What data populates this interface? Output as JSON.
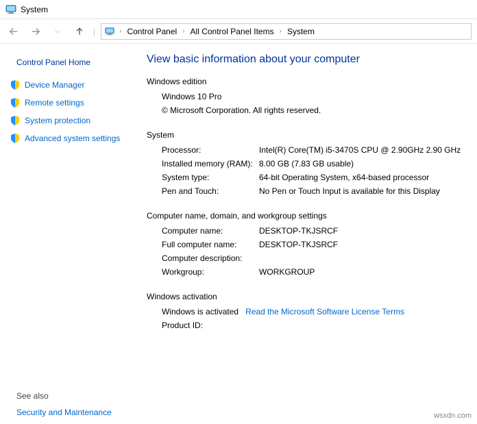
{
  "window": {
    "title": "System"
  },
  "breadcrumb": {
    "a": "Control Panel",
    "b": "All Control Panel Items",
    "c": "System"
  },
  "sidebar": {
    "home": "Control Panel Home",
    "items": [
      {
        "label": "Device Manager"
      },
      {
        "label": "Remote settings"
      },
      {
        "label": "System protection"
      },
      {
        "label": "Advanced system settings"
      }
    ],
    "seealso_head": "See also",
    "seealso_link": "Security and Maintenance"
  },
  "main": {
    "title": "View basic information about your computer",
    "edition": {
      "head": "Windows edition",
      "name": "Windows 10 Pro",
      "copyright": "© Microsoft Corporation. All rights reserved."
    },
    "system": {
      "head": "System",
      "processor_label": "Processor:",
      "processor_value": "Intel(R) Core(TM) i5-3470S CPU @ 2.90GHz   2.90 GHz",
      "ram_label": "Installed memory (RAM):",
      "ram_value": "8.00 GB (7.83 GB usable)",
      "type_label": "System type:",
      "type_value": "64-bit Operating System, x64-based processor",
      "pen_label": "Pen and Touch:",
      "pen_value": "No Pen or Touch Input is available for this Display"
    },
    "name": {
      "head": "Computer name, domain, and workgroup settings",
      "cname_label": "Computer name:",
      "cname_value": "DESKTOP-TKJSRCF",
      "fname_label": "Full computer name:",
      "fname_value": "DESKTOP-TKJSRCF",
      "desc_label": "Computer description:",
      "wg_label": "Workgroup:",
      "wg_value": "WORKGROUP"
    },
    "activation": {
      "head": "Windows activation",
      "status": "Windows is activated",
      "link": "Read the Microsoft Software License Terms",
      "pid_label": "Product ID:"
    }
  },
  "watermark": "wsxdn.com"
}
